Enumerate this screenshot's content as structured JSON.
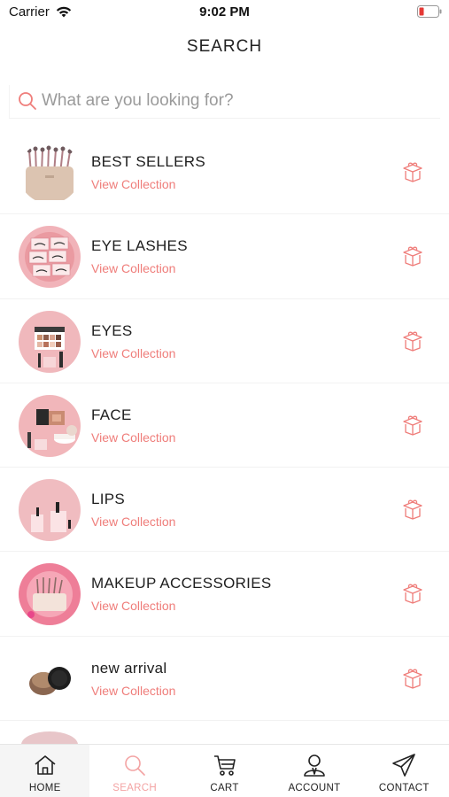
{
  "status": {
    "carrier": "Carrier",
    "time": "9:02 PM"
  },
  "header": {
    "title": "SEARCH"
  },
  "search": {
    "placeholder": "What are you looking for?"
  },
  "categories": [
    {
      "title": "BEST SELLERS",
      "link": "View Collection",
      "thumb": "brush-set-bag"
    },
    {
      "title": "EYE LASHES",
      "link": "View Collection",
      "thumb": "lash-boxes"
    },
    {
      "title": "EYES",
      "link": "View Collection",
      "thumb": "eyeshadow-palette"
    },
    {
      "title": "FACE",
      "link": "View Collection",
      "thumb": "face-palette"
    },
    {
      "title": "LIPS",
      "link": "View Collection",
      "thumb": "lipsticks"
    },
    {
      "title": "MAKEUP ACCESSORIES",
      "link": "View Collection",
      "thumb": "accessory-case"
    },
    {
      "title": "new arrival",
      "link": "View Collection",
      "thumb": "cream-jars"
    }
  ],
  "tabs": [
    {
      "label": "HOME",
      "icon": "home-icon"
    },
    {
      "label": "SEARCH",
      "icon": "search-icon",
      "active": true
    },
    {
      "label": "CART",
      "icon": "cart-icon"
    },
    {
      "label": "ACCOUNT",
      "icon": "account-icon"
    },
    {
      "label": "CONTACT",
      "icon": "send-icon"
    }
  ],
  "colors": {
    "accent": "#ef7d7a",
    "active_tab": "#f3a3a3",
    "thumb_bg": "#f0b9bd"
  }
}
